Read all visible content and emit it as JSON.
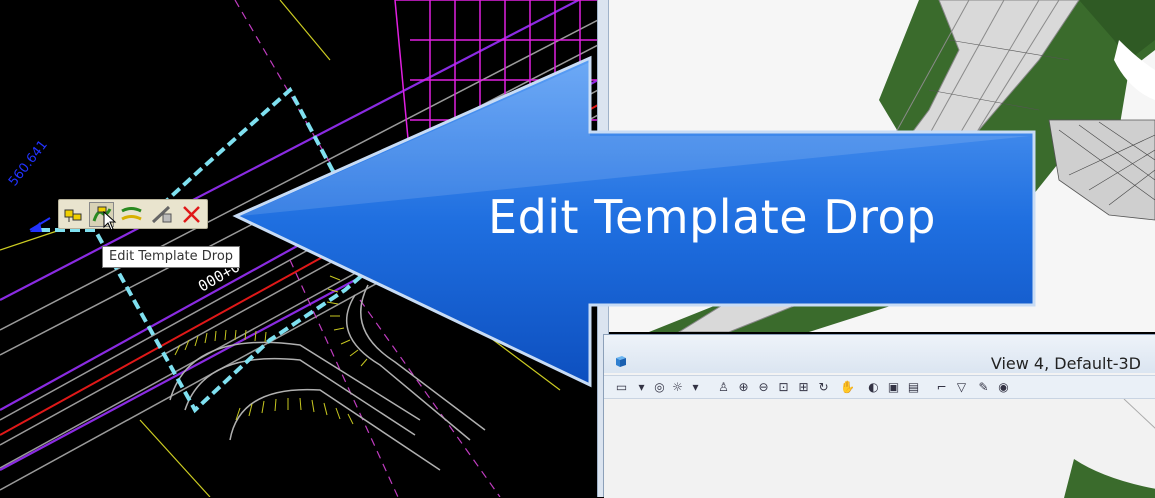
{
  "cad_view": {
    "station_label": "560.641",
    "station_text": "000+0"
  },
  "popup_toolbar": {
    "buttons": [
      {
        "icon": "template-drop-icon"
      },
      {
        "icon": "edit-template-drop-icon"
      },
      {
        "icon": "copy-template-drop-icon"
      },
      {
        "icon": "transition-icon"
      },
      {
        "icon": "delete-icon"
      }
    ]
  },
  "tooltip": {
    "text": "Edit Template Drop"
  },
  "callout": {
    "text": "Edit Template Drop",
    "color": "#1f6fe0"
  },
  "view4": {
    "title": "View 4, Default-3D"
  },
  "colors": {
    "popup_bg": "#e9e4ce",
    "template_line": "#7fe0f0",
    "terrain": "#3a6b2c"
  }
}
